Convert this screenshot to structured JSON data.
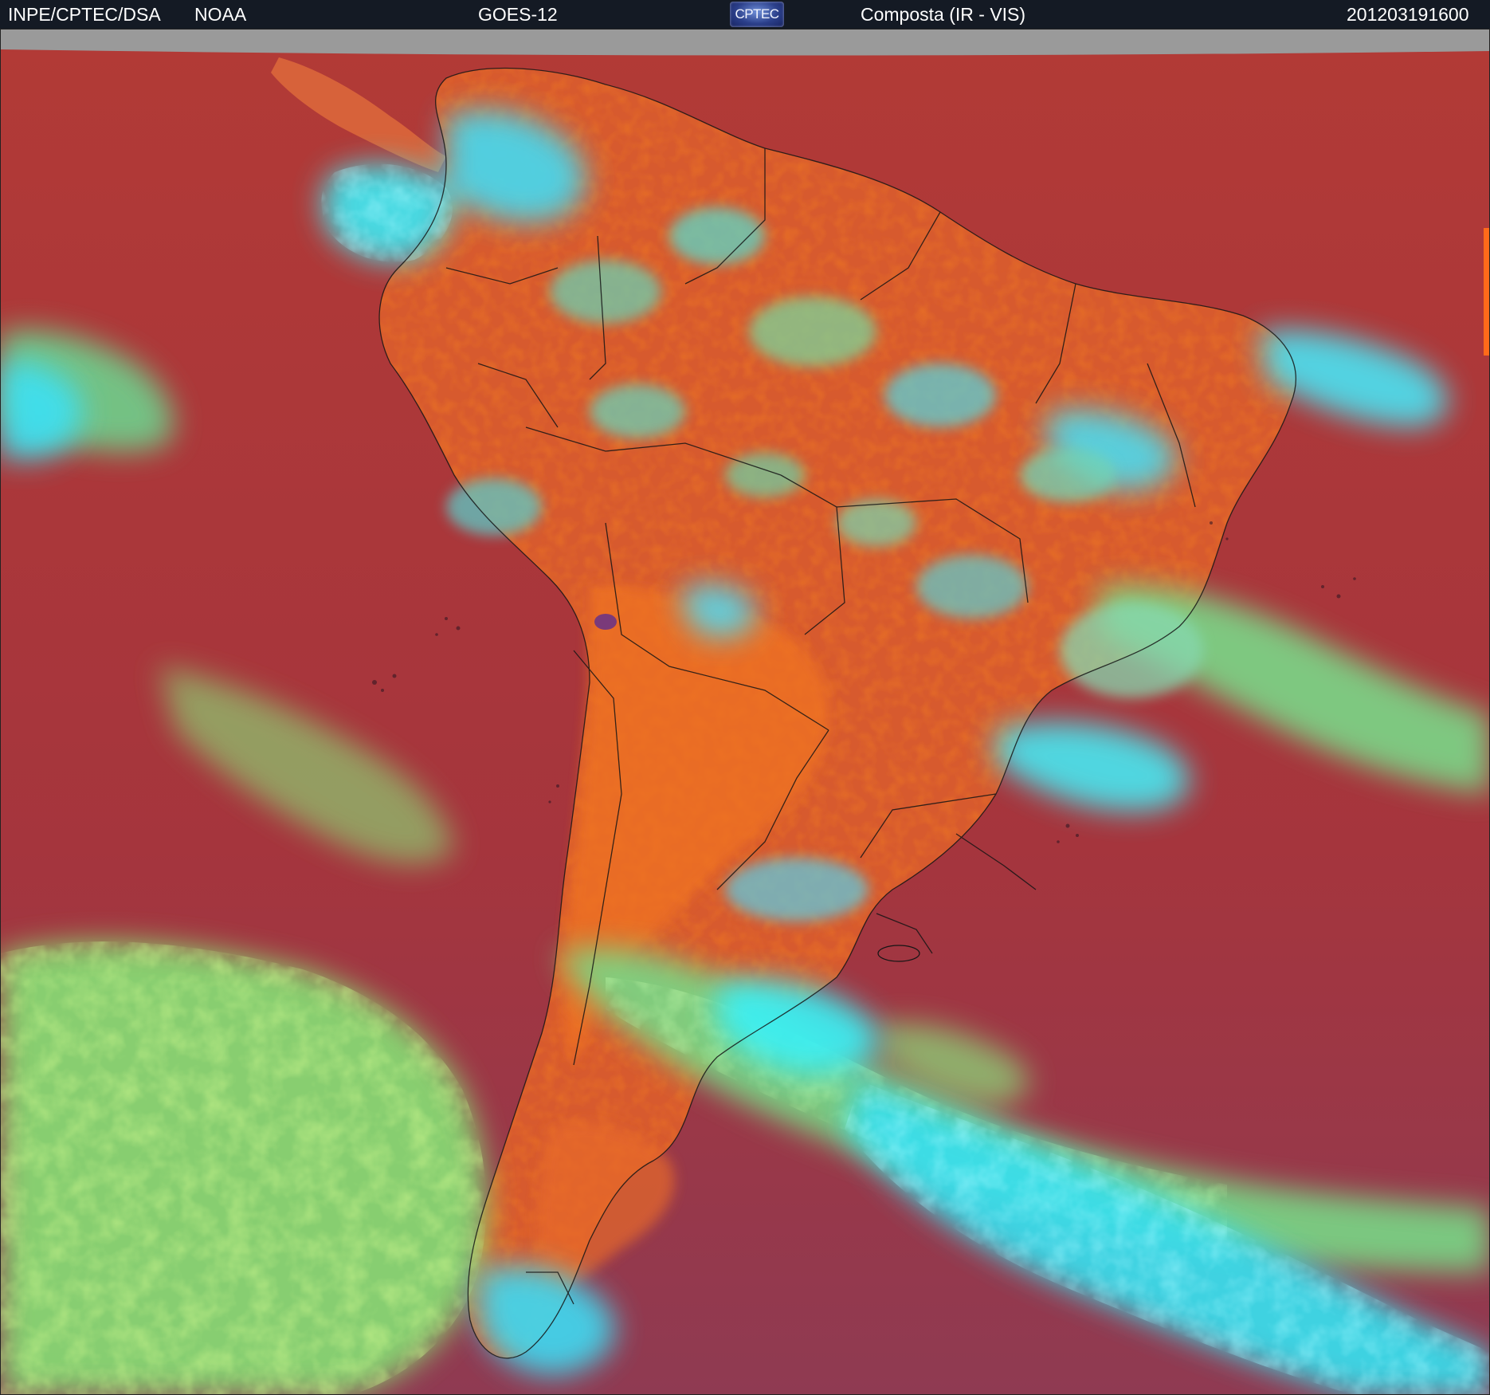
{
  "header": {
    "agency": "INPE/CPTEC/DSA",
    "source": "NOAA",
    "satellite": "GOES-12",
    "logo_text": "CPTEC",
    "product": "Composta (IR - VIS)",
    "timestamp": "201203191600"
  },
  "colors": {
    "header_bg": "#141a24",
    "ocean_clear": "#a8363c",
    "land_clear": "#e0662a",
    "low_cloud": "#7fe07a",
    "high_cloud": "#3fe6f0",
    "no_data": "#9a9a9a",
    "borders": "#1a1a1a"
  },
  "image": {
    "content": "satellite-composite-south-america",
    "icons": [
      "cptec-logo-icon"
    ]
  }
}
